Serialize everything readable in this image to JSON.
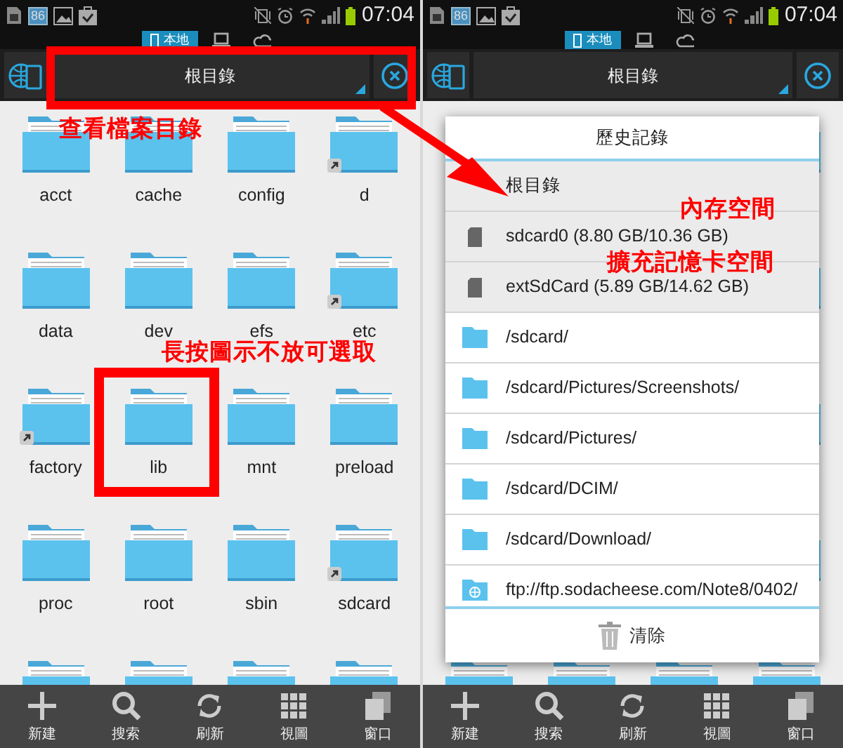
{
  "phones": [
    {
      "status_bar": {
        "badge": "86",
        "time": "07:04"
      },
      "location_tabs": [
        {
          "kind": "local",
          "label": "本地",
          "selected": true
        },
        {
          "kind": "lan",
          "selected": false
        },
        {
          "kind": "cloud",
          "selected": false
        }
      ],
      "path": "根目錄",
      "grid": [
        {
          "label": "acct",
          "link": false
        },
        {
          "label": "cache",
          "link": false
        },
        {
          "label": "config",
          "link": false
        },
        {
          "label": "d",
          "link": true
        },
        {
          "label": "data",
          "link": false
        },
        {
          "label": "dev",
          "link": false
        },
        {
          "label": "efs",
          "link": false
        },
        {
          "label": "etc",
          "link": true
        },
        {
          "label": "factory",
          "link": true
        },
        {
          "label": "lib",
          "link": false
        },
        {
          "label": "mnt",
          "link": false
        },
        {
          "label": "preload",
          "link": false
        },
        {
          "label": "proc",
          "link": false
        },
        {
          "label": "root",
          "link": false
        },
        {
          "label": "sbin",
          "link": false
        },
        {
          "label": "sdcard",
          "link": true
        }
      ],
      "bottom_bar": [
        {
          "kind": "new",
          "label": "新建"
        },
        {
          "kind": "search",
          "label": "搜索"
        },
        {
          "kind": "refresh",
          "label": "刷新"
        },
        {
          "kind": "view",
          "label": "視圖"
        },
        {
          "kind": "window",
          "label": "窗口"
        }
      ]
    },
    {
      "status_bar": {
        "badge": "86",
        "time": "07:04"
      },
      "location_tabs": [
        {
          "kind": "local",
          "label": "本地",
          "selected": true
        },
        {
          "kind": "lan",
          "selected": false
        },
        {
          "kind": "cloud",
          "selected": false
        }
      ],
      "path": "根目錄",
      "history_dialog": {
        "title": "歷史記錄",
        "items": [
          {
            "kind": "root",
            "label": "根目錄"
          },
          {
            "kind": "storage",
            "label": "sdcard0 (8.80 GB/10.36 GB)"
          },
          {
            "kind": "storage",
            "label": "extSdCard (5.89 GB/14.62 GB)"
          },
          {
            "kind": "folder",
            "label": "/sdcard/"
          },
          {
            "kind": "folder",
            "label": "/sdcard/Pictures/Screenshots/"
          },
          {
            "kind": "folder",
            "label": "/sdcard/Pictures/"
          },
          {
            "kind": "folder",
            "label": "/sdcard/DCIM/"
          },
          {
            "kind": "folder",
            "label": "/sdcard/Download/"
          },
          {
            "kind": "ftp",
            "label": "ftp://ftp.sodacheese.com/Note8/0402/"
          }
        ],
        "clear_button": "清除"
      },
      "bottom_bar": [
        {
          "kind": "new",
          "label": "新建"
        },
        {
          "kind": "search",
          "label": "搜索"
        },
        {
          "kind": "refresh",
          "label": "刷新"
        },
        {
          "kind": "view",
          "label": "視圖"
        },
        {
          "kind": "window",
          "label": "窗口"
        }
      ]
    }
  ],
  "annotations": [
    {
      "text": "查看檔案目錄"
    },
    {
      "text": "長按圖示不放可選取"
    },
    {
      "text": "內存空間"
    },
    {
      "text": "擴充記憶卡空間"
    }
  ]
}
